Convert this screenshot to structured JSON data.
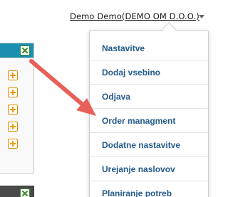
{
  "header": {
    "user_label": "Demo Demo(DEMO OM D.O.O.)",
    "caret_icon": "caret-down-icon"
  },
  "widget_panel": {
    "close_icon": "close-x-icon",
    "add_icon": "plus-icon",
    "add_button_count": 5,
    "header_color": "#1a8fb0",
    "add_color": "#ee9a00"
  },
  "dropdown": {
    "items": [
      {
        "label": "Nastavitve"
      },
      {
        "label": "Dodaj vsebino"
      },
      {
        "label": "Odjava"
      },
      {
        "label": "Order managment"
      },
      {
        "label": "Dodatne nastavitve"
      },
      {
        "label": "Urejanje naslovov"
      },
      {
        "label": "Planiranje potreb"
      }
    ],
    "text_color": "#235a8a"
  },
  "annotation": {
    "arrow_color": "#e8605a",
    "points_to": "Order managment"
  }
}
